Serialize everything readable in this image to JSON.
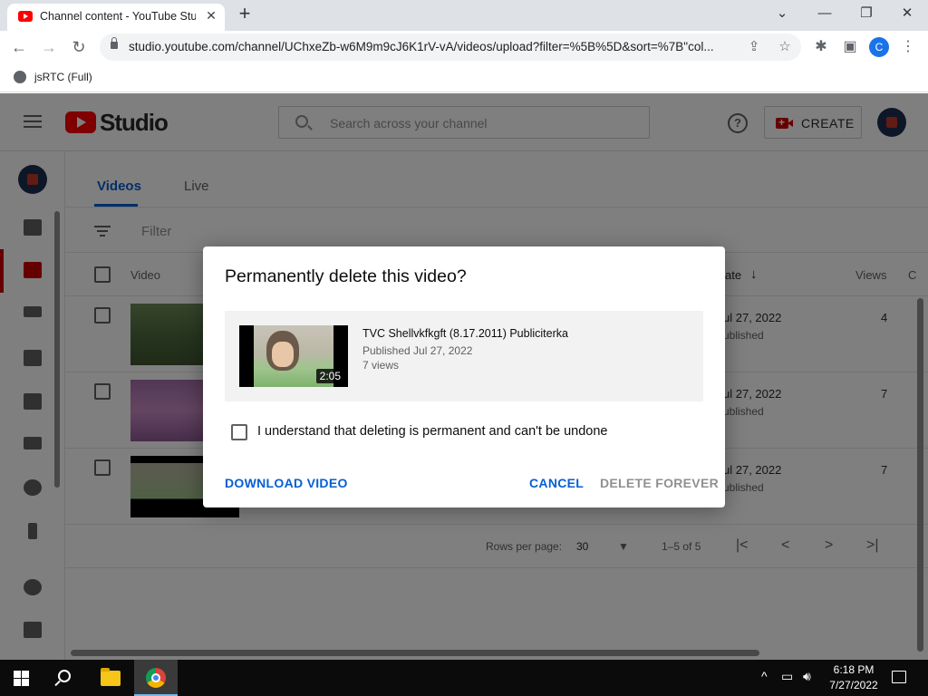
{
  "browser": {
    "tab_title": "Channel content - YouTube Studio",
    "url": "studio.youtube.com/channel/UChxeZb-w6M9m9cJ6K1rV-vA/videos/upload?filter=%5B%5D&sort=%7B\"col...",
    "profile_initial": "C",
    "bookmark_label": "jsRTC (Full)"
  },
  "studio": {
    "logo_text": "Studio",
    "search_placeholder": "Search across your channel",
    "create_label": "CREATE",
    "tabs": [
      "Videos",
      "Live"
    ],
    "filter_label": "Filter",
    "columns": {
      "video": "Video",
      "date": "ate",
      "views": "Views",
      "c": "C"
    },
    "rows": [
      {
        "date": "ul 27, 2022",
        "status": "ublished",
        "views": "4"
      },
      {
        "date": "ul 27, 2022",
        "status": "ublished",
        "views": "7"
      },
      {
        "date": "ul 27, 2022",
        "status": "ublished",
        "views": "7"
      }
    ],
    "pager": {
      "rows_per_page_label": "Rows per page:",
      "rows_per_page_value": "30",
      "range": "1–5 of 5"
    }
  },
  "dialog": {
    "title": "Permanently delete this video?",
    "video_title": "TVC Shellvkfkgft (8.17.2011) Publiciterka",
    "video_published": "Published Jul 27, 2022",
    "video_views": "7 views",
    "video_duration": "2:05",
    "checkbox_label": "I understand that deleting is permanent and can't be undone",
    "download_label": "DOWNLOAD VIDEO",
    "cancel_label": "CANCEL",
    "delete_label": "DELETE FOREVER"
  },
  "taskbar": {
    "time": "6:18 PM",
    "date": "7/27/2022"
  },
  "colors": {
    "accent_blue": "#065fd4",
    "youtube_red": "#ff0000",
    "disabled_gray": "#909090"
  }
}
